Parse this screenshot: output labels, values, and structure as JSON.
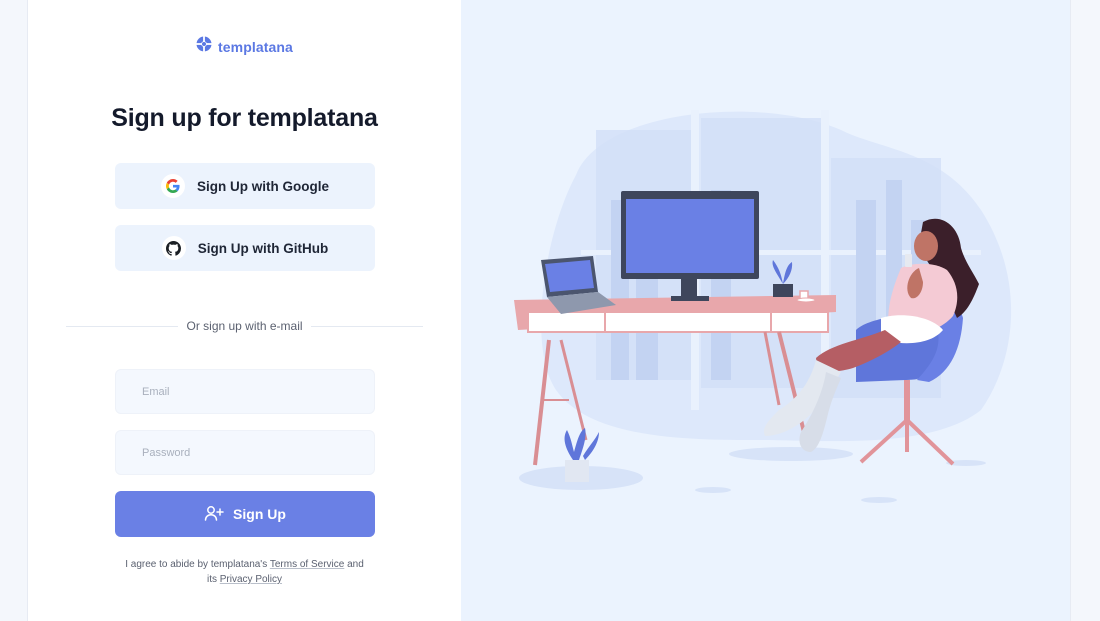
{
  "brand": {
    "name": "templatana",
    "accent": "#5b78e3"
  },
  "signup": {
    "title": "Sign up for templatana",
    "google_label": "Sign Up with Google",
    "github_label": "Sign Up with GitHub",
    "divider_text": "Or sign up with e-mail",
    "email_placeholder": "Email",
    "password_placeholder": "Password",
    "submit_label": "Sign Up",
    "legal": {
      "prefix": "I agree to abide by templatana's",
      "terms_link": "Terms of Service",
      "conjunction": "and",
      "its": "its",
      "privacy_link": "Privacy Policy"
    }
  },
  "icons": {
    "brand": "templatana-logo-icon",
    "google": "google-icon",
    "github": "github-icon",
    "add_user": "add-user-icon"
  },
  "colors": {
    "primary_button": "#6a80e5",
    "social_button_bg": "#ecf3fd",
    "illustration_bg": "#ebf3fe"
  }
}
